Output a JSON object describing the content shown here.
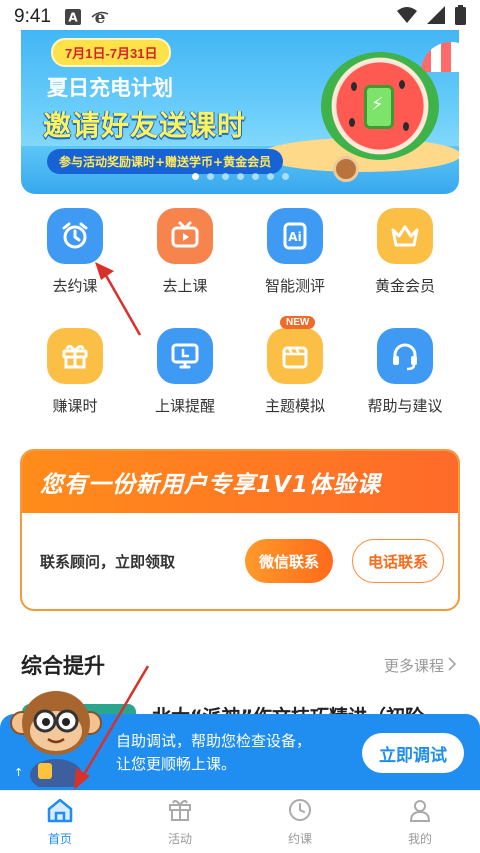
{
  "status_bar": {
    "time": "9:41"
  },
  "banner": {
    "date_range": "7月1日-7月31日",
    "subtitle": "夏日充电计划",
    "title": "邀请好友送课时",
    "tagline": "参与活动奖励课时+赠送学币+黄金会员",
    "slides": 7,
    "active_slide": 1
  },
  "quick_actions": [
    {
      "label": "去约课",
      "icon": "alarm-clock-icon",
      "color": "#3f9af4"
    },
    {
      "label": "去上课",
      "icon": "tv-icon",
      "color": "#f7834d"
    },
    {
      "label": "智能测评",
      "icon": "ai-icon",
      "color": "#3f9af4"
    },
    {
      "label": "黄金会员",
      "icon": "crown-icon",
      "color": "#fbbf45"
    },
    {
      "label": "赚课时",
      "icon": "gift-icon",
      "color": "#fbbf45"
    },
    {
      "label": "上课提醒",
      "icon": "monitor-icon",
      "color": "#3f9af4"
    },
    {
      "label": "主题模拟",
      "icon": "clapperboard-icon",
      "color": "#fbbf45",
      "badge": "NEW"
    },
    {
      "label": "帮助与建议",
      "icon": "headset-icon",
      "color": "#3f9af4"
    }
  ],
  "promo": {
    "title": "您有一份新用户专享1V1体验课",
    "text": "联系顾问，立即领取",
    "wechat_button": "微信联系",
    "phone_button": "电话联系"
  },
  "section": {
    "title": "综合提升",
    "more": "更多课程"
  },
  "course": {
    "title": "北大“派神”作文技巧精讲（初阶"
  },
  "notice": {
    "line1": "自助调试，帮助您检查设备，",
    "line2": "让您更顺畅上课。",
    "button": "立即调试",
    "up_indicator": "↑"
  },
  "bottom_nav": [
    {
      "label": "首页",
      "icon": "home-icon",
      "active": true
    },
    {
      "label": "活动",
      "icon": "gift-icon",
      "active": false
    },
    {
      "label": "约课",
      "icon": "clock-icon",
      "active": false
    },
    {
      "label": "我的",
      "icon": "person-icon",
      "active": false
    }
  ],
  "colors": {
    "primary": "#1f8ef0",
    "accent": "#ff6a1a",
    "arrow": "#d9312a"
  }
}
